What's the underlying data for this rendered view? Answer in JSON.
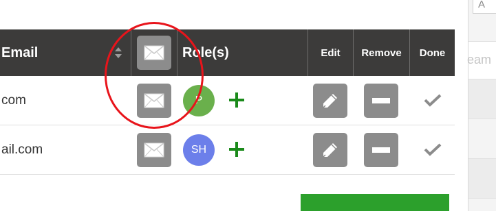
{
  "table": {
    "headers": {
      "email": "Email",
      "roles": "Role(s)",
      "edit": "Edit",
      "remove": "Remove",
      "done": "Done"
    },
    "rows": [
      {
        "email": "com",
        "avatar_initials": "P",
        "avatar_color": "#6ab04c"
      },
      {
        "email": "ail.com",
        "avatar_initials": "SH",
        "avatar_color": "#6c7fea"
      }
    ]
  },
  "right_panel": {
    "top_text": "A",
    "faded_text": "eam"
  },
  "colors": {
    "header_bg": "#3c3b3a",
    "button_gray": "#8c8c8c",
    "plus_green": "#1a8a1a",
    "primary_green": "#2ca02c",
    "annotation_red": "#e8141b"
  },
  "icons": {
    "mail": "envelope-icon",
    "sort": "sort-icon",
    "add": "plus-icon",
    "edit": "pencil-icon",
    "remove": "minus-icon",
    "done": "checkmark-icon"
  }
}
